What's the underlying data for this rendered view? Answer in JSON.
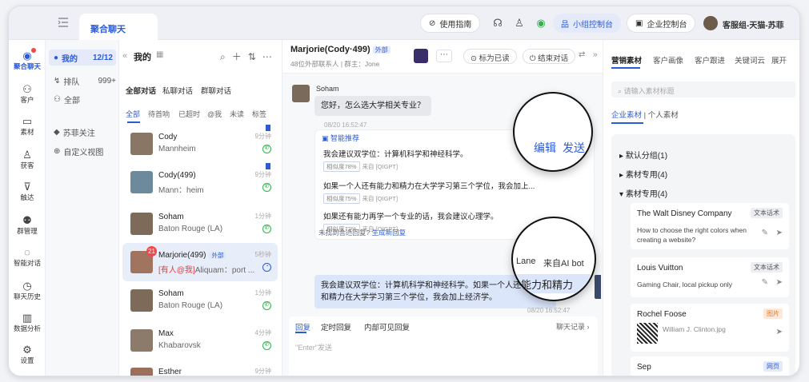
{
  "topbar": {
    "app_tab": "聚合聊天",
    "guide": "使用指南",
    "group_console": "小组控制台",
    "enterprise_console": "企业控制台",
    "user": "客服组-天猫-苏菲"
  },
  "leftnav": [
    {
      "label": "聚合聊天",
      "icon": "chat-icon"
    },
    {
      "label": "客户",
      "icon": "customer-icon"
    },
    {
      "label": "素材",
      "icon": "folder-icon"
    },
    {
      "label": "获客",
      "icon": "acquire-icon"
    },
    {
      "label": "触达",
      "icon": "funnel-icon"
    },
    {
      "label": "群管理",
      "icon": "group-icon"
    },
    {
      "label": "智能对话",
      "icon": "bulb-icon"
    },
    {
      "label": "聊天历史",
      "icon": "history-icon"
    },
    {
      "label": "数据分析",
      "icon": "chart-icon"
    },
    {
      "label": "设置",
      "icon": "gear-icon"
    }
  ],
  "views": {
    "mine_label": "我的",
    "mine_count": "12/12",
    "queue_label": "排队",
    "queue_count": "999+",
    "all_label": "全部",
    "focus_label": "苏菲关注",
    "custom_label": "自定义视图"
  },
  "convlist": {
    "header": "我的",
    "scope_tabs": [
      "全部对话",
      "私聊对话",
      "群聊对话"
    ],
    "filter_tabs": [
      "全部",
      "待首响",
      "已超时",
      "@我",
      "未读",
      "标签"
    ],
    "items": [
      {
        "name": "Cody",
        "sub": "Mannheim",
        "time": "9分钟"
      },
      {
        "name": "Cody(499)",
        "sub": "Mann：heim",
        "time": "9分钟"
      },
      {
        "name": "Soham",
        "sub": "Baton Rouge (LA)",
        "time": "1分钟"
      },
      {
        "name": "Marjorie(499)",
        "tag": "外部",
        "at": "[有人@我]",
        "sub": "Aliquam：port ...",
        "time": "5秒钟",
        "badge": "21"
      },
      {
        "name": "Soham",
        "sub": "Baton Rouge (LA)",
        "time": "1分钟"
      },
      {
        "name": "Max",
        "sub": "Khabarovsk",
        "time": "4分钟"
      },
      {
        "name": "Esther",
        "sub": "",
        "time": "9分钟"
      }
    ]
  },
  "chat": {
    "title": "Marjorie(Cody·499)",
    "title_tag": "外部",
    "subtitle": "48位外部联系人 | 群主：Jone",
    "mark_read": "标为已读",
    "end_chat": "结束对话",
    "sender": "Soham",
    "question": "您好，怎么选大学相关专业？",
    "time1": "08/20 16:52:47",
    "smart_label": "智能推荐",
    "suggestions": [
      {
        "text": "我会建议双学位：计算机科学和神经科学。",
        "sim": "相似度78%",
        "src": "来自 [QIGPT]"
      },
      {
        "text": "如果一个人还有能力和精力在大学学习第三个学位，我会加上...",
        "sim": "相似度75%",
        "src": "来自 [QIGPT]"
      },
      {
        "text": "如果还有能力再学一个专业的话，我会建议心理学。",
        "sim": "相似度72%",
        "src": "来自 [QIGPT]"
      }
    ],
    "not_found": "未找到合适回复?",
    "generate": "生成新回复",
    "reply": "我会建议双学位：计算机科学和神经科学。如果一个人还有能力和精力在大学学习第三个学位，我会加上经济学。",
    "time2": "08/20 16:52:47",
    "mag1_edit": "编辑",
    "mag1_send": "发送",
    "mag2_sender": "Lane",
    "mag2_src": "来自AI bot",
    "mag2_text": "能力和精力"
  },
  "composer": {
    "tabs": [
      "回复",
      "定时回复",
      "内部可见回复"
    ],
    "history": "聊天记录",
    "placeholder": "\"Enter\"发送"
  },
  "right": {
    "tabs": [
      "营销素材",
      "客户画像",
      "客户跟进",
      "关键词云",
      "展开"
    ],
    "search_placeholder": "请输入素材标题",
    "sub_tabs": [
      "企业素材",
      "个人素材"
    ],
    "tree": [
      "默认分组(1)",
      "素材专用(4)",
      "素材专用(4)"
    ],
    "cards": [
      {
        "title": "The Walt Disney Company",
        "tag": "文本话术",
        "body": "How to choose the right colors when creating a website?"
      },
      {
        "title": "Louis Vuitton",
        "tag": "文本话术",
        "body": "Gaming Chair, local pickup only"
      },
      {
        "title": "Rochel Foose",
        "tag": "图片",
        "body": "William J. Clinton.jpg"
      },
      {
        "title": "Sep",
        "tag": "网页",
        "body": ""
      }
    ]
  },
  "colors": {
    "accent": "#2b5bd7",
    "wechat": "#2fb34a",
    "bubble_me": "#dbe6fb",
    "bubble_other": "#e6e8ec"
  }
}
